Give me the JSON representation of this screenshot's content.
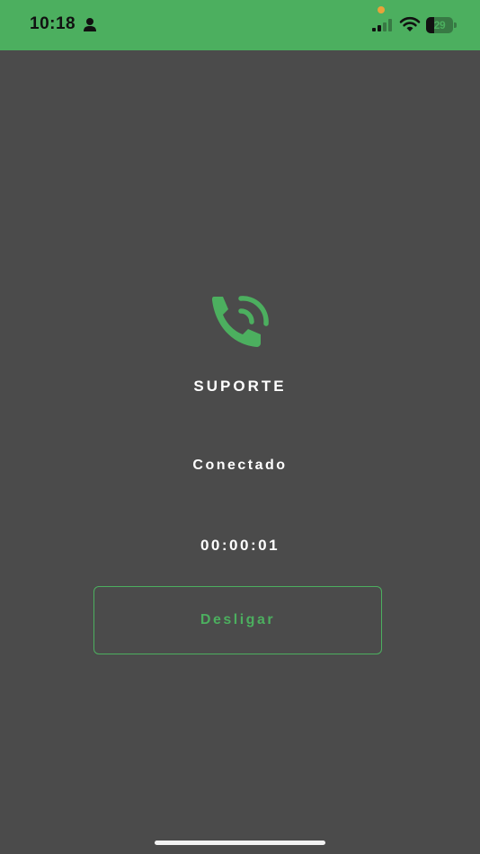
{
  "status_bar": {
    "time": "10:18",
    "battery_level": "29",
    "battery_fraction": 0.29,
    "icons": [
      "person-icon",
      "cellular-signal-icon",
      "wifi-icon",
      "battery-icon"
    ],
    "background_color": "#4caf5f",
    "privacy_dot_color": "#e8a23a"
  },
  "call": {
    "icon": "phone-ringing-icon",
    "caller_name": "SUPORTE",
    "status": "Conectado",
    "timer": "00:00:01",
    "hangup_label": "Desligar"
  },
  "colors": {
    "accent": "#4caf5f",
    "background": "#4b4b4b",
    "text": "#ffffff"
  }
}
